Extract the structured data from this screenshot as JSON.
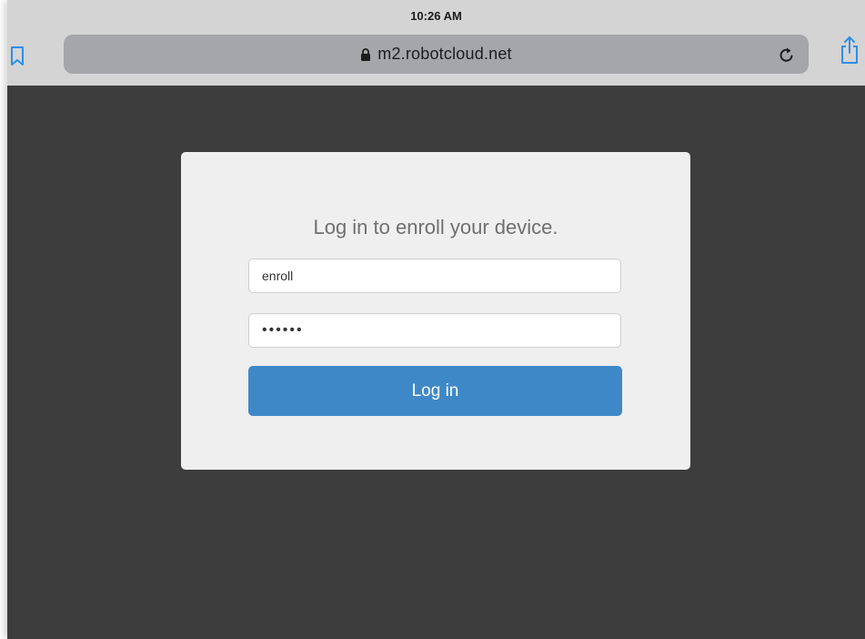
{
  "status_bar": {
    "time": "10:26 AM"
  },
  "browser": {
    "url": "m2.robotcloud.net",
    "icons": {
      "bookmarks": "bookmarks-icon",
      "lock": "lock-icon",
      "reload": "reload-icon",
      "share": "share-icon"
    },
    "accent_color": "#2f8ee6"
  },
  "login": {
    "heading": "Log in to enroll your device.",
    "username_value": "enroll",
    "password_value": "••••••",
    "button_label": "Log in",
    "button_color": "#3f88c8"
  },
  "colors": {
    "page_background": "#3d3d3d",
    "card_background": "#efefef",
    "toolbar_background": "#d4d4d4"
  }
}
